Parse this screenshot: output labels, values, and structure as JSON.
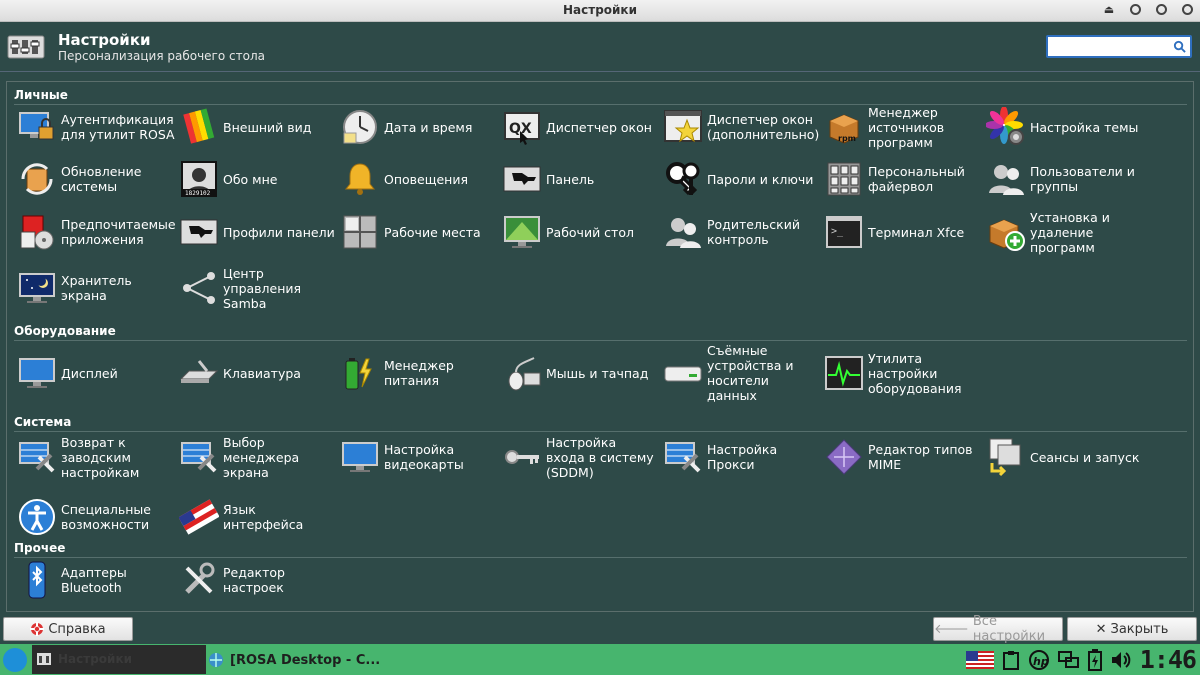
{
  "window": {
    "title": "Настройки"
  },
  "header": {
    "title": "Настройки",
    "subtitle": "Персонализация рабочего стола",
    "search_placeholder": ""
  },
  "sections": [
    {
      "label": "Личные",
      "items": [
        {
          "label": "Аутентификация\nдля утилит ROSA",
          "icon": "monitor-lock-icon"
        },
        {
          "label": "Внешний вид",
          "icon": "palette-icon"
        },
        {
          "label": "Дата и время",
          "icon": "clock-icon"
        },
        {
          "label": "Диспетчер окон",
          "icon": "window-manager-icon"
        },
        {
          "label": "Диспетчер окон\n(дополнительно)",
          "icon": "window-star-icon"
        },
        {
          "label": "Менеджер\nисточников\nпрограмм",
          "icon": "package-source-icon"
        },
        {
          "label": "Настройка темы",
          "icon": "theme-icon"
        },
        {
          "label": "Обновление\nсистемы",
          "icon": "update-icon"
        },
        {
          "label": "Обо мне",
          "icon": "about-me-icon"
        },
        {
          "label": "Оповещения",
          "icon": "bell-icon"
        },
        {
          "label": "Панель",
          "icon": "panel-icon"
        },
        {
          "label": "Пароли и ключи",
          "icon": "keys-icon"
        },
        {
          "label": "Персональный\nфайервол",
          "icon": "firewall-icon"
        },
        {
          "label": "Пользователи и\nгруппы",
          "icon": "users-icon"
        },
        {
          "label": "Предпочитаемые\nприложения",
          "icon": "preferred-apps-icon"
        },
        {
          "label": "Профили панели",
          "icon": "panel-profiles-icon"
        },
        {
          "label": "Рабочие места",
          "icon": "workspaces-icon"
        },
        {
          "label": "Рабочий стол",
          "icon": "desktop-icon"
        },
        {
          "label": "Родительский\nконтроль",
          "icon": "parental-control-icon"
        },
        {
          "label": "Терминал Xfce",
          "icon": "terminal-icon"
        },
        {
          "label": "Установка и\nудаление\nпрограмм",
          "icon": "install-remove-icon"
        },
        {
          "label": "Хранитель\nэкрана",
          "icon": "screensaver-icon"
        },
        {
          "label": "Центр\nуправления\nSamba",
          "icon": "samba-icon"
        }
      ]
    },
    {
      "label": "Оборудование",
      "items": [
        {
          "label": "Дисплей",
          "icon": "display-icon"
        },
        {
          "label": "Клавиатура",
          "icon": "keyboard-icon"
        },
        {
          "label": "Менеджер\nпитания",
          "icon": "battery-icon"
        },
        {
          "label": "Мышь и тачпад",
          "icon": "mouse-icon"
        },
        {
          "label": "Съёмные\nустройства и\nносители\nданных",
          "icon": "removable-drive-icon"
        },
        {
          "label": "Утилита\nнастройки\nоборудования",
          "icon": "hardware-monitor-icon"
        }
      ]
    },
    {
      "label": "Система",
      "items": [
        {
          "label": "Возврат к\nзаводским\nнастройкам",
          "icon": "factory-reset-icon"
        },
        {
          "label": "Выбор\nменеджера\nэкрана",
          "icon": "display-manager-icon"
        },
        {
          "label": "Настройка\nвидеокарты",
          "icon": "video-card-icon"
        },
        {
          "label": "Настройка\nвхода в систему\n(SDDM)",
          "icon": "login-key-icon"
        },
        {
          "label": "Настройка\nПрокси",
          "icon": "proxy-icon"
        },
        {
          "label": "Редактор типов\nMIME",
          "icon": "mime-icon"
        },
        {
          "label": "Сеансы и запуск",
          "icon": "sessions-icon"
        },
        {
          "label": "Специальные\nвозможности",
          "icon": "accessibility-icon"
        },
        {
          "label": "Язык\nинтерфейса",
          "icon": "language-flag-icon"
        }
      ]
    },
    {
      "label": "Прочее",
      "items": [
        {
          "label": "Адаптеры\nBluetooth",
          "icon": "bluetooth-icon"
        },
        {
          "label": "Редактор\nнастроек",
          "icon": "settings-editor-icon"
        }
      ]
    }
  ],
  "footer": {
    "help": "Справка",
    "all_settings": "Все настройки",
    "close": "Закрыть"
  },
  "taskbar": {
    "task2": "[ROSA Desktop - C...",
    "clock": "1:46"
  }
}
